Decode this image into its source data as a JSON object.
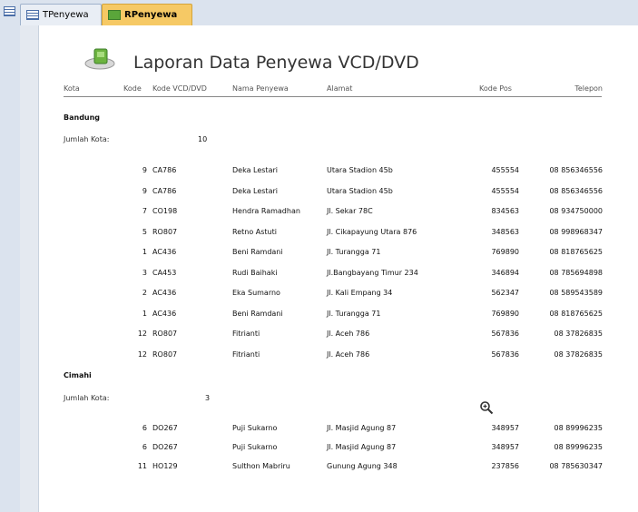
{
  "tabs": [
    {
      "label": "TPenyewa",
      "active": false
    },
    {
      "label": "RPenyewa",
      "active": true
    }
  ],
  "report": {
    "title": "Laporan Data Penyewa VCD/DVD",
    "columns": {
      "kota": "Kota",
      "kode": "Kode",
      "kode_vcd": "Kode VCD/DVD",
      "nama": "Nama Penyewa",
      "alamat": "Alamat",
      "kode_pos": "Kode Pos",
      "telepon": "Telepon"
    },
    "groups": [
      {
        "city": "Bandung",
        "count_label": "Jumlah Kota:",
        "count": "10",
        "rows": [
          {
            "kode": "9",
            "vcd": "CA786",
            "nama": "Deka Lestari",
            "alamat": "Utara Stadion 45b",
            "pos": "455554",
            "tel": "08 856346556"
          },
          {
            "kode": "9",
            "vcd": "CA786",
            "nama": "Deka Lestari",
            "alamat": "Utara Stadion 45b",
            "pos": "455554",
            "tel": "08 856346556"
          },
          {
            "kode": "7",
            "vcd": "CO198",
            "nama": "Hendra Ramadhan",
            "alamat": "Jl. Sekar 78C",
            "pos": "834563",
            "tel": "08 934750000"
          },
          {
            "kode": "5",
            "vcd": "RO807",
            "nama": "Retno Astuti",
            "alamat": "Jl. Cikapayung Utara 876",
            "pos": "348563",
            "tel": "08 998968347"
          },
          {
            "kode": "1",
            "vcd": "AC436",
            "nama": "Beni Ramdani",
            "alamat": "Jl. Turangga 71",
            "pos": "769890",
            "tel": "08 818765625"
          },
          {
            "kode": "3",
            "vcd": "CA453",
            "nama": "Rudi Baihaki",
            "alamat": "Jl.Bangbayang Timur 234",
            "pos": "346894",
            "tel": "08 785694898"
          },
          {
            "kode": "2",
            "vcd": "AC436",
            "nama": "Eka Sumarno",
            "alamat": "Jl. Kali Empang 34",
            "pos": "562347",
            "tel": "08 589543589"
          },
          {
            "kode": "1",
            "vcd": "AC436",
            "nama": "Beni Ramdani",
            "alamat": "Jl. Turangga 71",
            "pos": "769890",
            "tel": "08 818765625"
          },
          {
            "kode": "12",
            "vcd": "RO807",
            "nama": "Fitrianti",
            "alamat": "Jl. Aceh 786",
            "pos": "567836",
            "tel": "08 37826835"
          },
          {
            "kode": "12",
            "vcd": "RO807",
            "nama": "Fitrianti",
            "alamat": "Jl. Aceh 786",
            "pos": "567836",
            "tel": "08 37826835"
          }
        ]
      },
      {
        "city": "Cimahi",
        "count_label": "Jumlah Kota:",
        "count": "3",
        "rows": [
          {
            "kode": "6",
            "vcd": "DO267",
            "nama": "Puji Sukarno",
            "alamat": "Jl. Masjid Agung 87",
            "pos": "348957",
            "tel": "08 89996235"
          },
          {
            "kode": "6",
            "vcd": "DO267",
            "nama": "Puji Sukarno",
            "alamat": "Jl. Masjid Agung 87",
            "pos": "348957",
            "tel": "08 89996235"
          },
          {
            "kode": "11",
            "vcd": "HO129",
            "nama": "Sulthon Mabriru",
            "alamat": "Gunung Agung 348",
            "pos": "237856",
            "tel": "08 785630347"
          }
        ]
      }
    ]
  },
  "icons": {
    "logo": "report-logo-icon",
    "zoom": "magnifier-icon"
  }
}
